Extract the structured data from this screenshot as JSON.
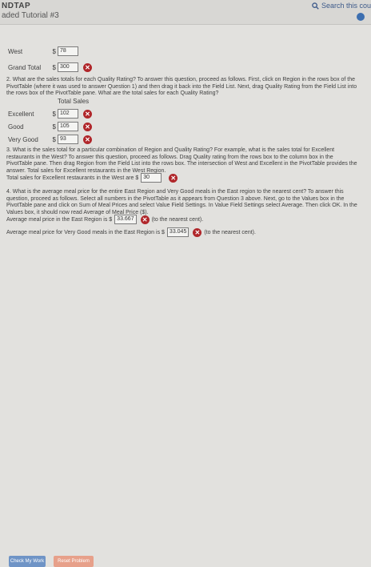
{
  "header": {
    "brand": "NDTAP",
    "tutorial": "aded Tutorial #3",
    "search": "Search this cou"
  },
  "q1": {
    "west_label": "West",
    "west_value": "78",
    "grand_label": "Grand Total",
    "currency": "$",
    "grand_value": "300"
  },
  "q2": {
    "text": "2. What are the sales totals for each Quality Rating? To answer this question, proceed as follows. First, click on Region in the rows box of the PivotTable (where it was used to answer Question 1) and then drag it back into the Field List. Next, drag Quality Rating from the Field List into the rows box of the PivotTable pane. What are the total sales for each Quality Rating?",
    "header": "Total Sales",
    "rows": [
      {
        "label": "Excellent",
        "currency": "$",
        "value": "102"
      },
      {
        "label": "Good",
        "currency": "$",
        "value": "105"
      },
      {
        "label": "Very Good",
        "currency": "$",
        "value": "93"
      }
    ]
  },
  "q3": {
    "text": "3. What is the sales total for a particular combination of Region and Quality Rating? For example, what is the sales total for Excellent restaurants in the West? To answer this question, proceed as follows. Drag Quality rating from the rows box to the column box in the PivotTable pane. Then drag Region from the Field List into the rows box. The intersection of West and Excellent in the PivotTable provides the answer. Total sales for Excellent restaurants in the West Region.",
    "answer_prefix": "Total sales for Excellent restaurants in the West are $",
    "answer_value": "30"
  },
  "q4": {
    "text": "4. What is the average meal price for the entire East Region and Very Good meals in the East region to the nearest cent? To answer this question, proceed as follows. Select all numbers in the PivotTable as it appears from Question 3 above. Next, go to the Values box in the PivotTable pane and click on Sum of Meal Prices and select Value Field Settings. In Value Field Settings select Average. Then click OK. In the Values box, it should now read Average of Meal Price ($).",
    "line1_prefix": "Average meal price in the East Region is $",
    "line1_value": "33.667",
    "line1_suffix": "(to the nearest cent).",
    "line2_prefix": "Average meal price for Very Good meals in the East Region is $",
    "line2_value": "33.045",
    "line2_suffix": "(to the nearest cent)."
  },
  "buttons": {
    "check": "Check My Work",
    "nav": "Reset Problem"
  },
  "colors": {
    "error": "#b0262a",
    "accent": "#6f94c6",
    "secondary": "#e7a08a"
  }
}
